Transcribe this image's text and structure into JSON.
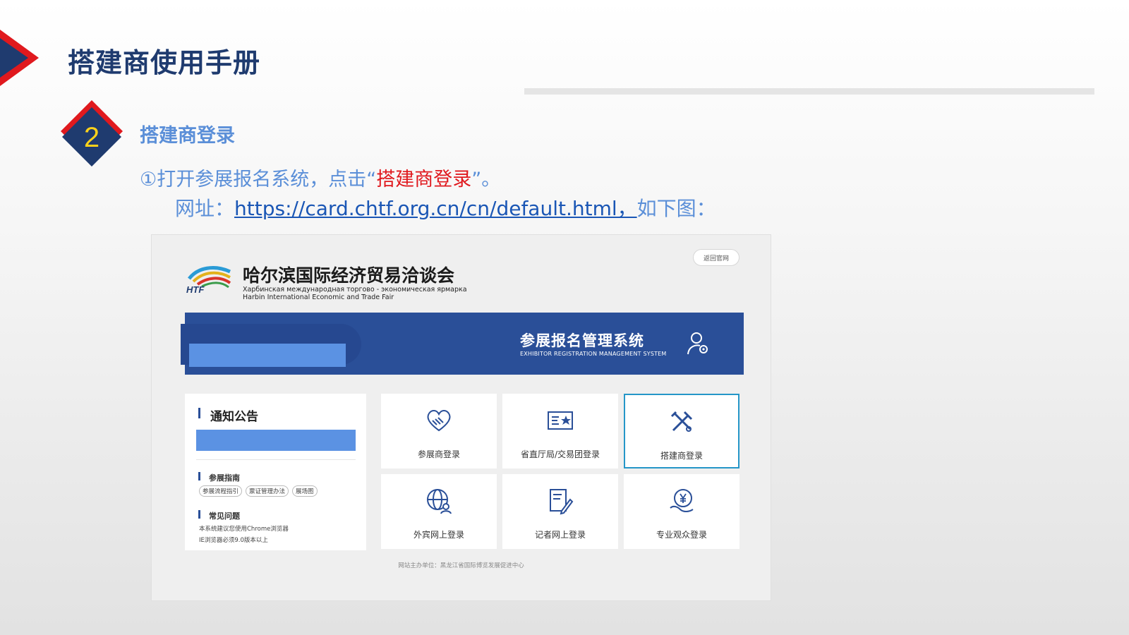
{
  "page": {
    "title": "搭建商使用手册",
    "step_number": "2",
    "section_title": "搭建商登录",
    "instruction_prefix": "①打开参展报名系统，点击“",
    "instruction_highlight": "搭建商登录",
    "instruction_suffix": "”。",
    "url_prefix": "网址：",
    "url_link": "https://card.chtf.org.cn/cn/default.html，",
    "url_suffix": "如下图："
  },
  "colors": {
    "title": "#1f3b6f",
    "accent_blue": "#5b8fd8",
    "highlight_red": "#e0191e",
    "banner": "#2a4f98",
    "active_border": "#2596c8"
  },
  "screenshot": {
    "back_button": "返回官网",
    "logo_text": "HTF",
    "fair_name_cn": "哈尔滨国际经济贸易洽谈会",
    "fair_name_ru": "Харбинская международная торгово - экономическая ярмарка",
    "fair_name_en": "Harbin International Economic and Trade Fair",
    "system_title": "参展报名管理系统",
    "system_subtitle": "EXHIBITOR REGISTRATION MANAGEMENT SYSTEM",
    "notice": {
      "title": "通知公告",
      "guide_title": "参展指南",
      "guide_tags": [
        "参展流程指引",
        "票证管理办法",
        "展场图"
      ],
      "faq_title": "常见问题",
      "faq_lines": [
        "本系统建议您使用Chrome浏览器",
        "IE浏览器必须9.0版本以上"
      ]
    },
    "tiles": [
      {
        "label": "参展商登录",
        "icon": "handshake-heart-icon",
        "active": false
      },
      {
        "label": "省直厅局/交易团登录",
        "icon": "id-card-star-icon",
        "active": false
      },
      {
        "label": "搭建商登录",
        "icon": "tools-icon",
        "active": true
      },
      {
        "label": "外宾网上登录",
        "icon": "globe-user-icon",
        "active": false
      },
      {
        "label": "记者网上登录",
        "icon": "document-pen-icon",
        "active": false
      },
      {
        "label": "专业观众登录",
        "icon": "yuan-person-icon",
        "active": false
      }
    ],
    "footer": "网站主办单位：黑龙江省国际博览发展促进中心"
  }
}
